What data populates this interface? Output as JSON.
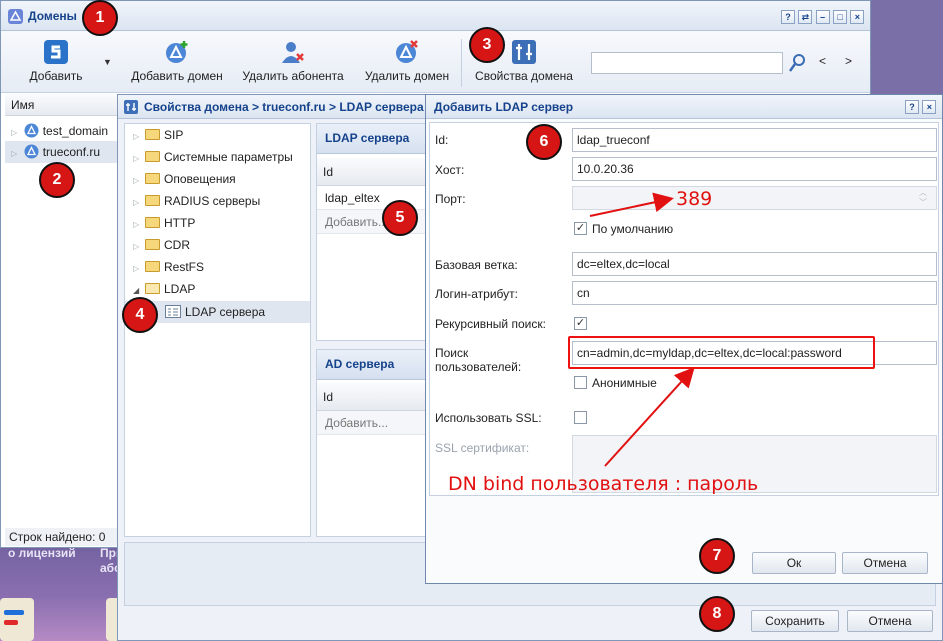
{
  "domains_window": {
    "title": "Домены",
    "toolbar": {
      "add": "Добавить",
      "add_domain": "Добавить домен",
      "delete_subscriber": "Удалить абонента",
      "delete_domain": "Удалить домен",
      "domain_properties": "Свойства домена",
      "search_value": "",
      "prev": "<",
      "next": ">"
    },
    "list_header": "Имя",
    "domains": [
      "test_domain",
      "trueconf.ru"
    ],
    "rows_found_label": "Строк найдено: 0"
  },
  "background": {
    "text1": "о лицензий",
    "text2": "При",
    "text3": "або"
  },
  "properties_window": {
    "title": "Свойства домена > trueconf.ru > LDAP сервера",
    "tree": [
      "SIP",
      "Системные параметры",
      "Оповещения",
      "RADIUS серверы",
      "HTTP",
      "CDR",
      "RestFS",
      "LDAP",
      "LDAP сервера"
    ],
    "ldap_panel": {
      "title": "LDAP сервера",
      "col_id": "Id",
      "rows": [
        "ldap_eltex"
      ],
      "add": "Добавить..."
    },
    "ad_panel": {
      "title": "AD сервера",
      "col_id": "Id",
      "add": "Добавить..."
    },
    "save_button": "Сохранить",
    "cancel_button": "Отмена"
  },
  "add_ldap_dialog": {
    "title": "Добавить LDAP сервер",
    "fields": {
      "id_label": "Id:",
      "id_value": "ldap_trueconf",
      "host_label": "Хост:",
      "host_value": "10.0.20.36",
      "port_label": "Порт:",
      "port_value": "",
      "default_label": "По умолчанию",
      "base_label": "Базовая ветка:",
      "base_value": "dc=eltex,dc=local",
      "login_attr_label": "Логин-атрибут:",
      "login_attr_value": "cn",
      "recursive_label": "Рекурсивный поиск:",
      "user_search_label": "Поиск пользователей:",
      "user_search_value": "cn=admin,dc=myldap,dc=eltex,dc=local:password",
      "anonymous_label": "Анонимные",
      "ssl_label": "Использовать SSL:",
      "ssl_cert_label": "SSL сертификат:",
      "ssl_cert_value": ""
    },
    "ok_button": "Ок",
    "cancel_button": "Отмена"
  },
  "annotations": {
    "port_note": "389",
    "dn_note": "DN bind пользователя : пароль",
    "badges": [
      "1",
      "2",
      "3",
      "4",
      "5",
      "6",
      "7",
      "8"
    ],
    "accent_color": "#e11111"
  }
}
